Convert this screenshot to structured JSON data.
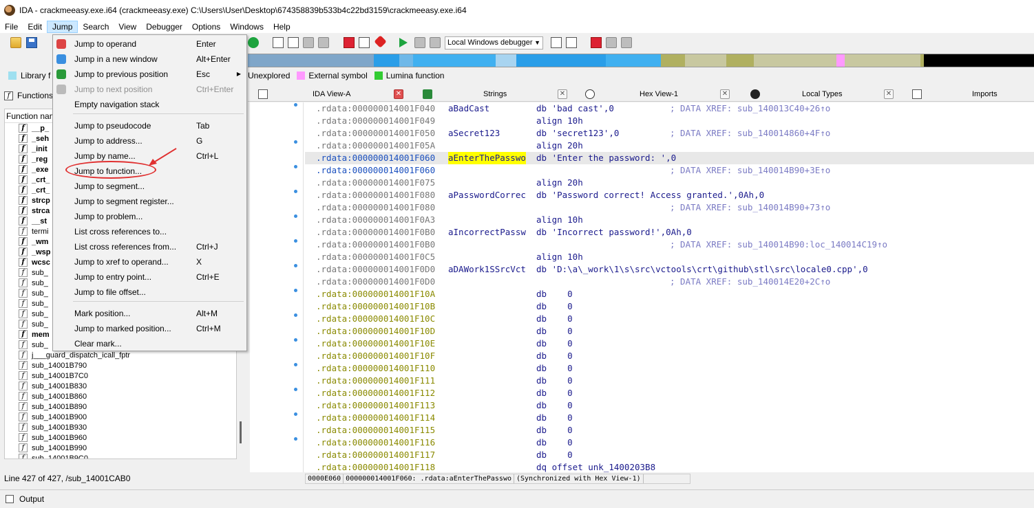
{
  "window": {
    "title": "IDA - crackmeeasy.exe.i64 (crackmeeasy.exe) C:\\Users\\User\\Desktop\\674358839b533b4c22bd3159\\crackmeeasy.exe.i64"
  },
  "menu": [
    "File",
    "Edit",
    "Jump",
    "Search",
    "View",
    "Debugger",
    "Options",
    "Windows",
    "Help"
  ],
  "toolbar": {
    "debugger_select": "Local Windows debugger"
  },
  "legend": {
    "left_label": "Library f",
    "items": [
      {
        "label": "Unexplored",
        "color": "#c8c8a0"
      },
      {
        "label": "External symbol",
        "color": "#ff99ff"
      },
      {
        "label": "Lumina function",
        "color": "#33cc33"
      }
    ]
  },
  "jump_menu": {
    "items": [
      {
        "label": "Jump to operand",
        "shortcut": "Enter",
        "icon": "operand-icon"
      },
      {
        "label": "Jump in a new window",
        "shortcut": "Alt+Enter",
        "icon": "new-window-icon"
      },
      {
        "label": "Jump to previous position",
        "shortcut": "Esc",
        "icon": "back-arrow-icon"
      },
      {
        "label": "Jump to next position",
        "shortcut": "Ctrl+Enter",
        "icon": "forward-arrow-icon",
        "disabled": true
      },
      {
        "label": "Empty navigation stack",
        "shortcut": ""
      },
      {
        "label": "Jump to pseudocode",
        "shortcut": "Tab"
      },
      {
        "label": "Jump to address...",
        "shortcut": "G"
      },
      {
        "label": "Jump by name...",
        "shortcut": "Ctrl+L"
      },
      {
        "label": "Jump to function...",
        "shortcut": ""
      },
      {
        "label": "Jump to segment...",
        "shortcut": ""
      },
      {
        "label": "Jump to segment register...",
        "shortcut": ""
      },
      {
        "label": "Jump to problem...",
        "shortcut": ""
      },
      {
        "label": "List cross references to...",
        "shortcut": ""
      },
      {
        "label": "List cross references from...",
        "shortcut": "Ctrl+J"
      },
      {
        "label": "Jump to xref to operand...",
        "shortcut": "X"
      },
      {
        "label": "Jump to entry point...",
        "shortcut": "Ctrl+E"
      },
      {
        "label": "Jump to file offset...",
        "shortcut": ""
      },
      {
        "label": "Mark position...",
        "shortcut": "Alt+M"
      },
      {
        "label": "Jump to marked position...",
        "shortcut": "Ctrl+M"
      },
      {
        "label": "Clear mark...",
        "shortcut": ""
      }
    ]
  },
  "functions_panel": {
    "title": "Functions",
    "column": "Function nam",
    "rows": [
      {
        "name": "__p_",
        "bold": true
      },
      {
        "name": "_seh",
        "bold": true
      },
      {
        "name": "_init",
        "bold": true
      },
      {
        "name": "_reg",
        "bold": true
      },
      {
        "name": "_exe",
        "bold": true
      },
      {
        "name": "_crt_",
        "bold": true
      },
      {
        "name": "_crt_",
        "bold": true
      },
      {
        "name": "strcp",
        "bold": true
      },
      {
        "name": "strca",
        "bold": true
      },
      {
        "name": "__st",
        "bold": true
      },
      {
        "name": "termi",
        "bold": false
      },
      {
        "name": "_wm",
        "bold": true
      },
      {
        "name": "_wsp",
        "bold": true
      },
      {
        "name": "wcsc",
        "bold": true
      },
      {
        "name": "sub_",
        "bold": false
      },
      {
        "name": "sub_",
        "bold": false
      },
      {
        "name": "sub_",
        "bold": false
      },
      {
        "name": "sub_",
        "bold": false
      },
      {
        "name": "sub_",
        "bold": false
      },
      {
        "name": "sub_",
        "bold": false
      },
      {
        "name": "mem",
        "bold": true
      },
      {
        "name": "sub_",
        "bold": false
      },
      {
        "name": "j___guard_dispatch_icall_fptr",
        "bold": false
      },
      {
        "name": "sub_14001B790",
        "bold": false
      },
      {
        "name": "sub_14001B7C0",
        "bold": false
      },
      {
        "name": "sub_14001B830",
        "bold": false
      },
      {
        "name": "sub_14001B860",
        "bold": false
      },
      {
        "name": "sub_14001B890",
        "bold": false
      },
      {
        "name": "sub_14001B900",
        "bold": false
      },
      {
        "name": "sub_14001B930",
        "bold": false
      },
      {
        "name": "sub_14001B960",
        "bold": false
      },
      {
        "name": "sub_14001B990",
        "bold": false
      },
      {
        "name": "sub_14001B9C0",
        "bold": false
      }
    ],
    "status": "Line 427 of 427, /sub_14001CAB0"
  },
  "tabs": [
    {
      "label": "IDA View-A",
      "icon": "ida-view-icon",
      "close_red": true
    },
    {
      "label": "Strings",
      "icon": "strings-icon",
      "close_red": false
    },
    {
      "label": "Hex View-1",
      "icon": "hex-view-icon",
      "close_red": false
    },
    {
      "label": "Local Types",
      "icon": "local-types-icon",
      "close_red": false
    },
    {
      "label": "Imports",
      "icon": "imports-icon",
      "close_red": false
    }
  ],
  "disasm": [
    {
      "addr": ".rdata:000000014001F040",
      "label": "aBadCast",
      "ins": "db 'bad cast',0",
      "cmt": "; DATA XREF: sub_140013C40+26↑o",
      "style": "grey"
    },
    {
      "addr": ".rdata:000000014001F049",
      "label": "",
      "ins": "align 10h",
      "cmt": "",
      "style": "grey"
    },
    {
      "addr": ".rdata:000000014001F050",
      "label": "aSecret123",
      "ins": "db 'secret123',0",
      "cmt": "; DATA XREF: sub_140014860+4F↑o",
      "style": "grey"
    },
    {
      "addr": ".rdata:000000014001F05A",
      "label": "",
      "ins": "align 20h",
      "cmt": "",
      "style": "grey"
    },
    {
      "addr": ".rdata:000000014001F060",
      "label": "aEnterThePasswo",
      "ins": "db 'Enter the password: ',0",
      "cmt": "",
      "style": "blue",
      "current": true,
      "highlight": true
    },
    {
      "addr": ".rdata:000000014001F060",
      "label": "",
      "ins": "",
      "cmt": "; DATA XREF: sub_140014B90+3E↑o",
      "style": "blue"
    },
    {
      "addr": ".rdata:000000014001F075",
      "label": "",
      "ins": "align 20h",
      "cmt": "",
      "style": "grey"
    },
    {
      "addr": ".rdata:000000014001F080",
      "label": "aPasswordCorrec",
      "ins": "db 'Password correct! Access granted.',0Ah,0",
      "cmt": "",
      "style": "grey"
    },
    {
      "addr": ".rdata:000000014001F080",
      "label": "",
      "ins": "",
      "cmt": "; DATA XREF: sub_140014B90+73↑o",
      "style": "grey"
    },
    {
      "addr": ".rdata:000000014001F0A3",
      "label": "",
      "ins": "align 10h",
      "cmt": "",
      "style": "grey"
    },
    {
      "addr": ".rdata:000000014001F0B0",
      "label": "aIncorrectPassw",
      "ins": "db 'Incorrect password!',0Ah,0",
      "cmt": "",
      "style": "grey"
    },
    {
      "addr": ".rdata:000000014001F0B0",
      "label": "",
      "ins": "",
      "cmt": "; DATA XREF: sub_140014B90:loc_140014C19↑o",
      "style": "grey"
    },
    {
      "addr": ".rdata:000000014001F0C5",
      "label": "",
      "ins": "align 10h",
      "cmt": "",
      "style": "grey"
    },
    {
      "addr": ".rdata:000000014001F0D0",
      "label": "aDAWork1SSrcVct",
      "ins": "db 'D:\\a\\_work\\1\\s\\src\\vctools\\crt\\github\\stl\\src\\locale0.cpp',0",
      "cmt": "",
      "style": "grey"
    },
    {
      "addr": ".rdata:000000014001F0D0",
      "label": "",
      "ins": "",
      "cmt": "; DATA XREF: sub_140014E20+2C↑o",
      "style": "grey"
    },
    {
      "addr": ".rdata:000000014001F10A",
      "label": "",
      "ins": "db    0",
      "cmt": "",
      "style": "olive"
    },
    {
      "addr": ".rdata:000000014001F10B",
      "label": "",
      "ins": "db    0",
      "cmt": "",
      "style": "olive"
    },
    {
      "addr": ".rdata:000000014001F10C",
      "label": "",
      "ins": "db    0",
      "cmt": "",
      "style": "olive"
    },
    {
      "addr": ".rdata:000000014001F10D",
      "label": "",
      "ins": "db    0",
      "cmt": "",
      "style": "olive"
    },
    {
      "addr": ".rdata:000000014001F10E",
      "label": "",
      "ins": "db    0",
      "cmt": "",
      "style": "olive"
    },
    {
      "addr": ".rdata:000000014001F10F",
      "label": "",
      "ins": "db    0",
      "cmt": "",
      "style": "olive"
    },
    {
      "addr": ".rdata:000000014001F110",
      "label": "",
      "ins": "db    0",
      "cmt": "",
      "style": "olive"
    },
    {
      "addr": ".rdata:000000014001F111",
      "label": "",
      "ins": "db    0",
      "cmt": "",
      "style": "olive"
    },
    {
      "addr": ".rdata:000000014001F112",
      "label": "",
      "ins": "db    0",
      "cmt": "",
      "style": "olive"
    },
    {
      "addr": ".rdata:000000014001F113",
      "label": "",
      "ins": "db    0",
      "cmt": "",
      "style": "olive"
    },
    {
      "addr": ".rdata:000000014001F114",
      "label": "",
      "ins": "db    0",
      "cmt": "",
      "style": "olive"
    },
    {
      "addr": ".rdata:000000014001F115",
      "label": "",
      "ins": "db    0",
      "cmt": "",
      "style": "olive"
    },
    {
      "addr": ".rdata:000000014001F116",
      "label": "",
      "ins": "db    0",
      "cmt": "",
      "style": "olive"
    },
    {
      "addr": ".rdata:000000014001F117",
      "label": "",
      "ins": "db    0",
      "cmt": "",
      "style": "olive"
    },
    {
      "addr": ".rdata:000000014001F118",
      "label": "",
      "ins": "dq offset unk_1400203B8",
      "cmt": "",
      "style": "olive"
    }
  ],
  "disasm_status": [
    "0000E060",
    "000000014001F060: .rdata:aEnterThePasswo",
    "(Synchronized with Hex View-1)"
  ],
  "output": {
    "label": "Output"
  }
}
